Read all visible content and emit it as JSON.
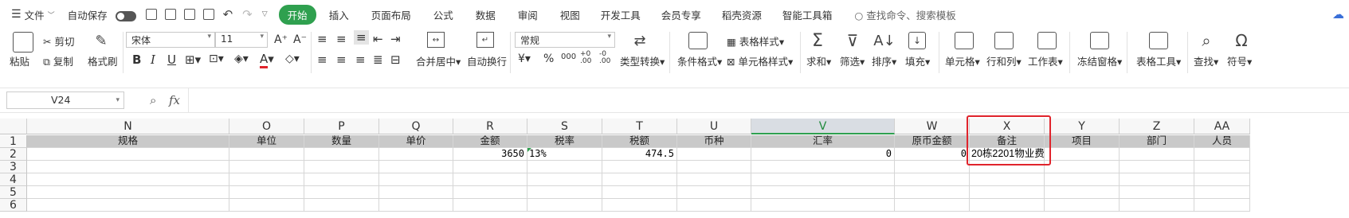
{
  "menubar": {
    "file_label": "文件",
    "autosave_label": "自动保存",
    "menus": [
      "插入",
      "页面布局",
      "公式",
      "数据",
      "审阅",
      "视图",
      "开发工具",
      "会员专享",
      "稻壳资源",
      "智能工具箱"
    ],
    "active_menu": "开始",
    "search_placeholder": "查找命令、搜索模板"
  },
  "ribbon": {
    "paste": "粘贴",
    "cut": "剪切",
    "copy": "复制",
    "format_painter": "格式刷",
    "font_name": "宋体",
    "font_size": "11",
    "merge_center": "合并居中",
    "wrap_text": "自动换行",
    "number_format": "常规",
    "type_convert": "类型转换",
    "conditional_format": "条件格式",
    "table_style": "表格样式",
    "cell_style": "单元格样式",
    "sum": "求和",
    "filter": "筛选",
    "sort": "排序",
    "fill": "填充",
    "cell": "单元格",
    "row_col": "行和列",
    "worksheet": "工作表",
    "freeze": "冻结窗格",
    "table_tools": "表格工具",
    "find": "查找",
    "symbol": "符号"
  },
  "formula_bar": {
    "cell_ref": "V24",
    "fx_label": "fx",
    "formula": ""
  },
  "grid": {
    "columns": [
      "N",
      "O",
      "P",
      "Q",
      "R",
      "S",
      "T",
      "U",
      "V",
      "W",
      "X",
      "Y",
      "Z",
      "AA"
    ],
    "active_column": "V",
    "row_numbers": [
      "1",
      "2",
      "3",
      "4",
      "5",
      "6"
    ],
    "header_row": [
      "规格",
      "单位",
      "数量",
      "单价",
      "金额",
      "税率",
      "税额",
      "币种",
      "汇率",
      "原币金额",
      "备注",
      "项目",
      "部门",
      "人员"
    ],
    "data_row": [
      "",
      "",
      "",
      "",
      "3650",
      "13%",
      "474.5",
      "",
      "0",
      "0",
      "20栋2201物业费",
      "",
      "",
      ""
    ]
  },
  "colors": {
    "accent": "#2fa04f",
    "highlight_box": "#e0242c",
    "header_fill": "#c9c9c9"
  }
}
